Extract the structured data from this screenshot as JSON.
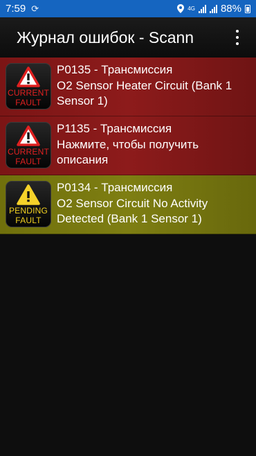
{
  "status_bar": {
    "time": "7:59",
    "network_label": "4G",
    "battery": "88%",
    "icons": [
      "sync-icon",
      "location-icon",
      "signal-icon",
      "battery-icon"
    ]
  },
  "app_bar": {
    "title": "Журнал ошибок - Scann"
  },
  "faults": [
    {
      "status": "current",
      "badge_line1": "CURRENT",
      "badge_line2": "FAULT",
      "code": "P0135 - Трансмиссия",
      "description": "O2 Sensor Heater Circuit (Bank 1 Sensor 1)",
      "color": "#8a1a1a"
    },
    {
      "status": "current",
      "badge_line1": "CURRENT",
      "badge_line2": "FAULT",
      "code": "P1135 - Трансмиссия",
      "description": "Нажмите, чтобы получить описания",
      "color": "#8a1a1a"
    },
    {
      "status": "pending",
      "badge_line1": "PENDING",
      "badge_line2": "FAULT",
      "code": "P0134 - Трансмиссия",
      "description": "O2 Sensor Circuit No Activity Detected (Bank 1 Sensor 1)",
      "color": "#7a7a10"
    }
  ],
  "colors": {
    "status_bar": "#1565c0",
    "current_fault_text": "#e02020",
    "pending_fault_text": "#f0d020",
    "background": "#0e0e0e"
  }
}
